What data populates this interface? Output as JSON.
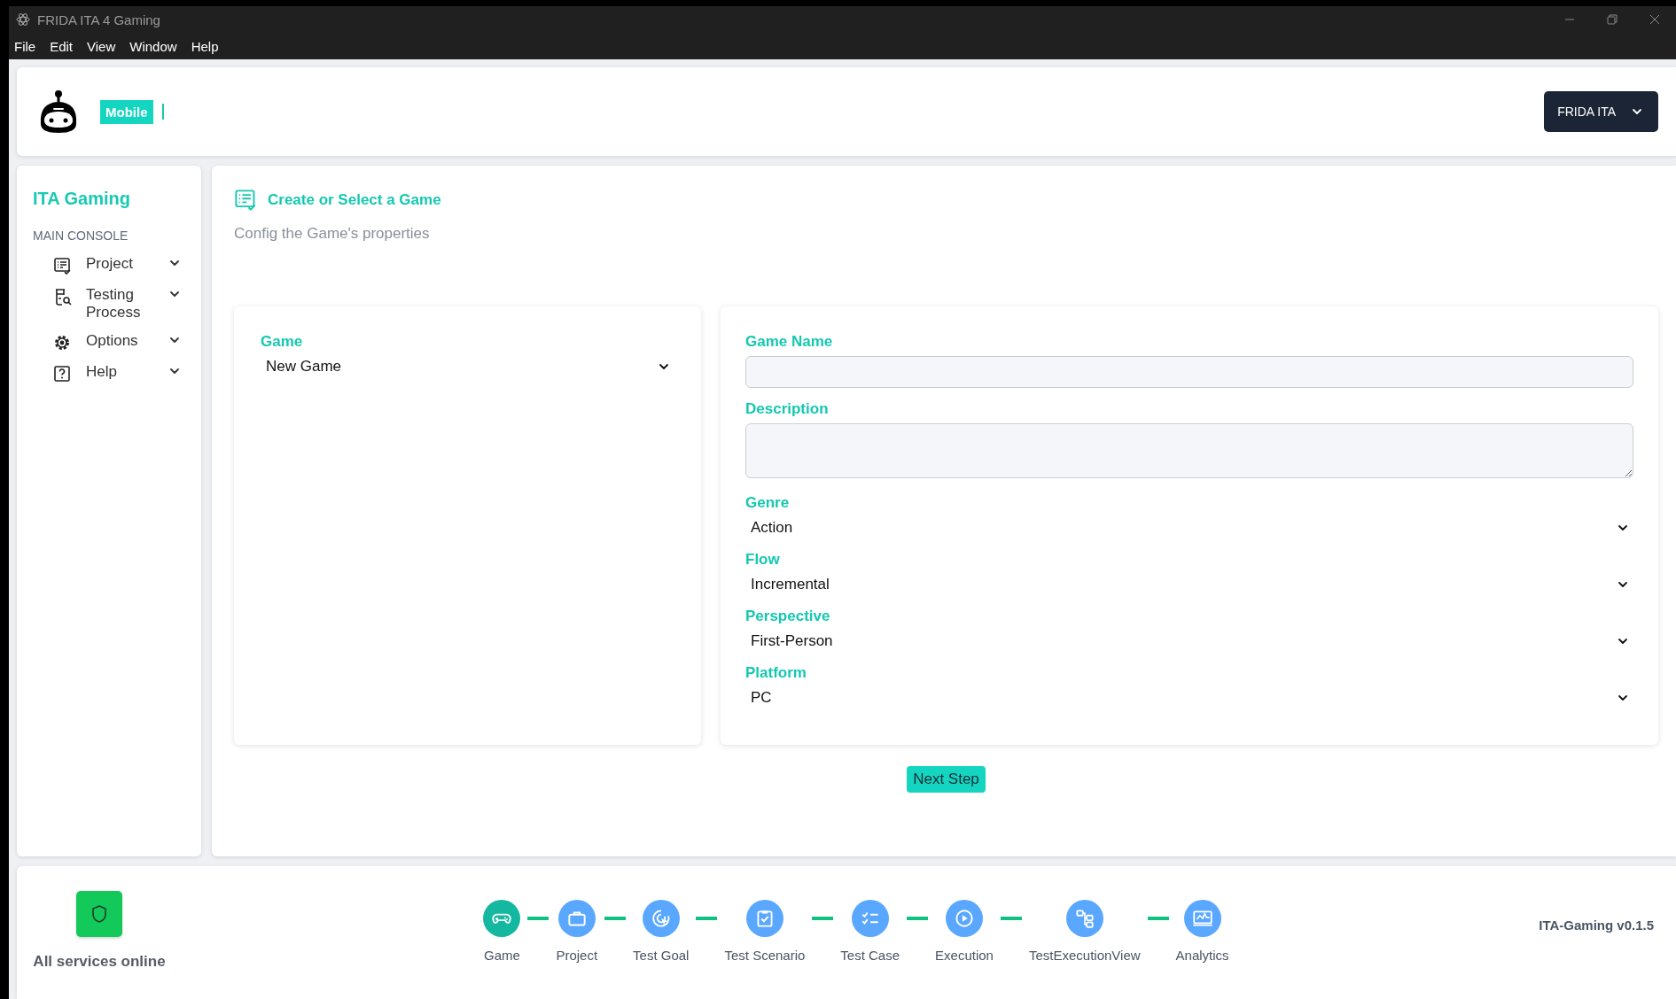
{
  "window": {
    "title": "FRIDA ITA 4 Gaming"
  },
  "menu": [
    "File",
    "Edit",
    "View",
    "Window",
    "Help"
  ],
  "header": {
    "badge": "Mobile",
    "user_menu": "FRIDA ITA"
  },
  "sidebar": {
    "title": "ITA Gaming",
    "section": "MAIN CONSOLE",
    "items": [
      {
        "label": "Project",
        "expanded": false
      },
      {
        "label": "Testing Process",
        "expanded": false
      },
      {
        "label": "Options",
        "expanded": false
      },
      {
        "label": "Help",
        "expanded": false
      }
    ]
  },
  "page": {
    "title": "Create or Select a Game",
    "subtitle": "Config the Game's properties"
  },
  "game_select": {
    "label": "Game",
    "value": "New Game"
  },
  "fields": [
    {
      "kind": "input",
      "label": "Game Name"
    },
    {
      "kind": "textarea",
      "label": "Description"
    },
    {
      "kind": "select",
      "label": "Genre",
      "value": "Action"
    },
    {
      "kind": "select",
      "label": "Flow",
      "value": "Incremental"
    },
    {
      "kind": "select",
      "label": "Perspective",
      "value": "First-Person"
    },
    {
      "kind": "select",
      "label": "Platform",
      "value": "PC"
    }
  ],
  "next_button": "Next Step",
  "status": {
    "label": "All services online"
  },
  "steps": [
    {
      "label": "Game",
      "selected": true
    },
    {
      "label": "Project",
      "selected": false
    },
    {
      "label": "Test Goal",
      "selected": false
    },
    {
      "label": "Test Scenario",
      "selected": false
    },
    {
      "label": "Test Case",
      "selected": false
    },
    {
      "label": "Execution",
      "selected": false
    },
    {
      "label": "TestExecutionView",
      "selected": false
    },
    {
      "label": "Analytics",
      "selected": false
    }
  ],
  "version": "ITA-Gaming v0.1.5"
}
